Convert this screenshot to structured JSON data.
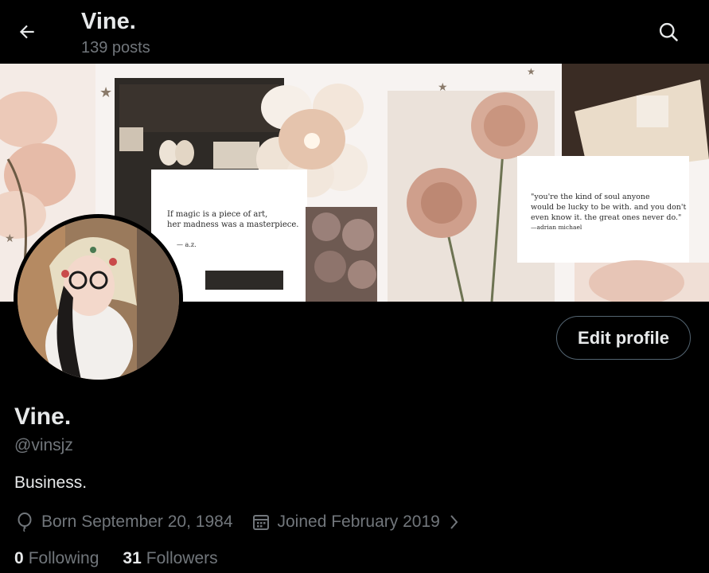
{
  "header": {
    "title": "Vine.",
    "post_count": "139 posts",
    "back_icon": "arrow-left-icon",
    "search_icon": "search-icon"
  },
  "banner": {
    "quote_left_line1": "If magic is a piece of art,",
    "quote_left_line2": "her madness was a masterpiece.",
    "quote_left_author": "— a.z.",
    "quote_right_line1": "\"you're the kind of soul anyone",
    "quote_right_line2": "would be lucky to be with. and you don't",
    "quote_right_line3": "even know it. the great ones never do.\"",
    "quote_right_author": "—adrian michael"
  },
  "profile": {
    "edit_button": "Edit profile",
    "display_name": "Vine.",
    "handle": "@vinsjz",
    "bio": "Business.",
    "birthday": "Born September 20, 1984",
    "joined": "Joined February 2019",
    "following_count": "0",
    "following_label": "Following",
    "followers_count": "31",
    "followers_label": "Followers"
  },
  "colors": {
    "background": "#000000",
    "text_primary": "#e7e9ea",
    "text_secondary": "#71767b",
    "border": "#536471"
  }
}
